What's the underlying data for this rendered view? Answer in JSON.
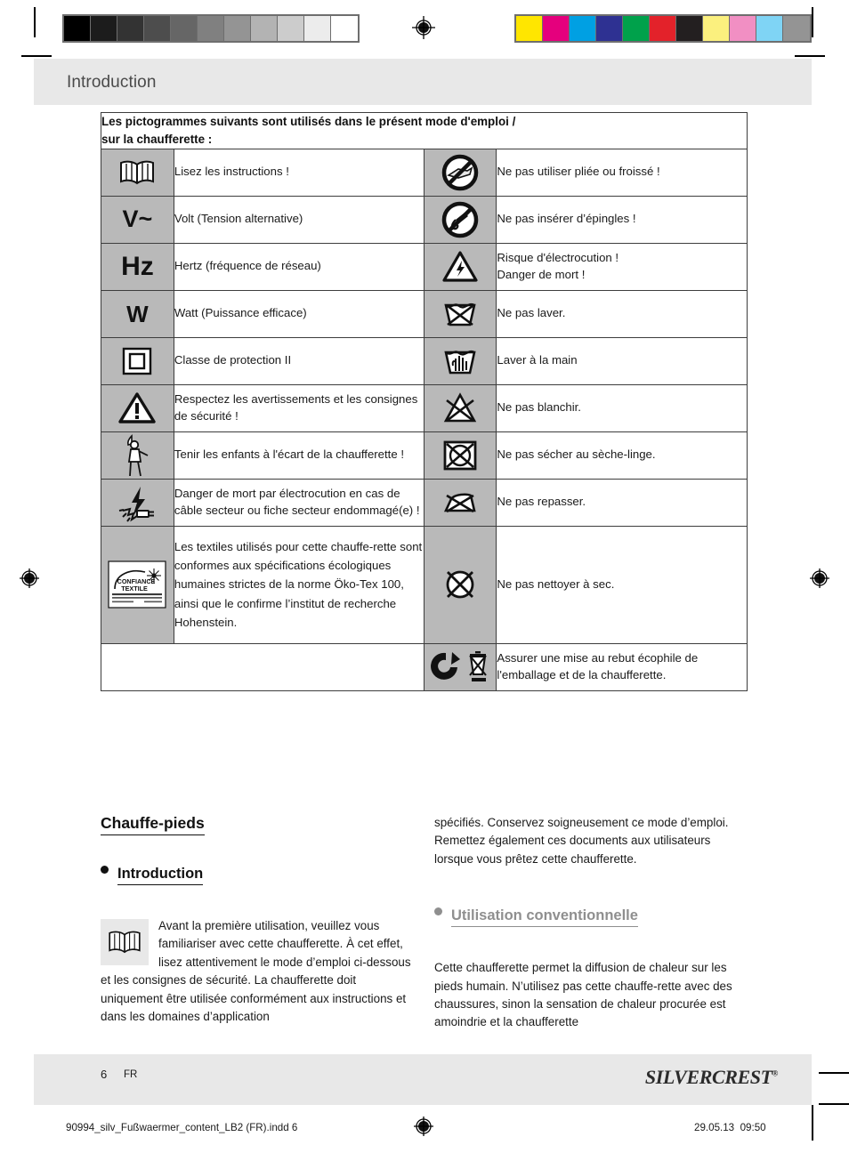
{
  "page": {
    "title": "Introduction",
    "number": "6",
    "language": "FR",
    "brand": "SilverCrest",
    "brand_mark": "®"
  },
  "print_marks": {
    "gray_bar": [
      "#000000",
      "#1c1c1c",
      "#333333",
      "#4d4d4d",
      "#666666",
      "#808080",
      "#949494",
      "#b3b3b3",
      "#cccccc",
      "#ececec",
      "#ffffff"
    ],
    "color_bar": [
      "#ffe600",
      "#e5007d",
      "#00a0e3",
      "#2e3192",
      "#00a14b",
      "#e3222a",
      "#231f20",
      "#fbf07e",
      "#f18fc3",
      "#7fd4f5",
      "#949494"
    ],
    "registration_icon": "registration-target-icon"
  },
  "table": {
    "header": "Les pictogrammes suivants sont utilisés dans le présent mode d'emploi / sur la chaufferette :",
    "rows": [
      {
        "left": {
          "icon": "open-book-icon",
          "icon_text": "",
          "text": "Lisez les instructions !"
        },
        "right": {
          "icon": "no-folded-use-icon",
          "icon_text": "",
          "text": "Ne pas utiliser pliée ou froissé !"
        }
      },
      {
        "left": {
          "icon": "volt-symbol",
          "icon_text": "V~",
          "text": "Volt (Tension alternative)"
        },
        "right": {
          "icon": "no-pins-icon",
          "icon_text": "",
          "text": "Ne pas insérer d’épingles !"
        }
      },
      {
        "left": {
          "icon": "hertz-symbol",
          "icon_text": "Hz",
          "text": "Hertz (fréquence de réseau)"
        },
        "right": {
          "icon": "electric-shock-warning-icon",
          "icon_text": "",
          "text": "Risque d'électrocution !\nDanger de mort !"
        }
      },
      {
        "left": {
          "icon": "watt-symbol",
          "icon_text": "W",
          "text": "Watt (Puissance efficace)"
        },
        "right": {
          "icon": "do-not-wash-icon",
          "icon_text": "",
          "text": "Ne pas laver."
        }
      },
      {
        "left": {
          "icon": "protection-class-two-icon",
          "icon_text": "",
          "text": "Classe de protection II"
        },
        "right": {
          "icon": "hand-wash-icon",
          "icon_text": "",
          "text": "Laver à la main"
        }
      },
      {
        "left": {
          "icon": "warning-triangle-icon",
          "icon_text": "",
          "text": "Respectez les avertissements et les consignes de sécurité !"
        },
        "right": {
          "icon": "do-not-bleach-icon",
          "icon_text": "",
          "text": "Ne pas blanchir."
        }
      },
      {
        "left": {
          "icon": "keep-children-away-icon",
          "icon_text": "",
          "text": "Tenir les enfants à l'écart de la chaufferette !"
        },
        "right": {
          "icon": "do-not-tumble-dry-icon",
          "icon_text": "",
          "text": "Ne pas sécher au sèche-linge."
        }
      },
      {
        "left": {
          "icon": "damaged-plug-danger-icon",
          "icon_text": "",
          "text": "Danger de mort par électrocution en cas de câble secteur ou fiche secteur endommagé(e) !"
        },
        "right": {
          "icon": "do-not-iron-icon",
          "icon_text": "",
          "text": "Ne pas repasser."
        }
      },
      {
        "left": {
          "icon": "oeko-tex-confidence-textile-label",
          "icon_text": "",
          "text": "Les textiles utilisés pour cette chauffe-rette sont conformes aux spécifications écologiques humaines strictes de la norme Öko-Tex 100, ainsi que le confirme l’institut de recherche Hohenstein."
        },
        "right": {
          "icon": "do-not-dry-clean-icon",
          "icon_text": "",
          "text": "Ne pas nettoyer à sec."
        }
      },
      {
        "left": {
          "icon": "",
          "icon_text": "",
          "text": ""
        },
        "right": {
          "icon": "recycle-and-weee-icon",
          "icon_text": "",
          "text": "Assurer une mise au rebut écophile de l'emballage et de la chaufferette."
        }
      }
    ],
    "oeko_label": {
      "line1": "CONFIANCE",
      "line2": "TEXTILE",
      "line3": "Textile satisfaisant aux tests",
      "line4": "d'après Öko-Tex® Standard 100",
      "line5": "06.0.65074",
      "line6": "Hohenstein"
    }
  },
  "content": {
    "product_heading": "Chauffe-pieds",
    "intro_heading": "Introduction",
    "intro_icon": "open-book-icon",
    "intro_paragraph": "Avant la première utilisation, veuillez vous familiariser avec cette chaufferette. À cet effet, lisez attentivement le mode d’emploi ci-dessous et les consignes de sécurité. La chaufferette doit uniquement être utilisée conformément aux instructions et dans les domaines d’application",
    "intro_continuation": "spécifiés. Conservez soigneusement ce mode d’emploi. Remettez également ces documents aux utilisateurs lorsque vous prêtez cette chaufferette.",
    "usage_heading": "Utilisation conventionnelle",
    "usage_paragraph": "Cette chaufferette permet la diffusion de chaleur sur les pieds humain. N’utilisez pas cette chauffe-rette avec des chaussures, sinon la sensation de chaleur procurée est amoindrie et la chaufferette"
  },
  "imprint": {
    "file": "90994_silv_Fußwaermer_content_LB2 (FR).indd   6",
    "date": "29.05.13",
    "time": "09:50"
  },
  "colors": {
    "band_gray": "#e8e8e8",
    "icon_cell_gray": "#b9b9b9",
    "muted_heading": "#8f8f8f",
    "text": "#1a1a1a"
  }
}
